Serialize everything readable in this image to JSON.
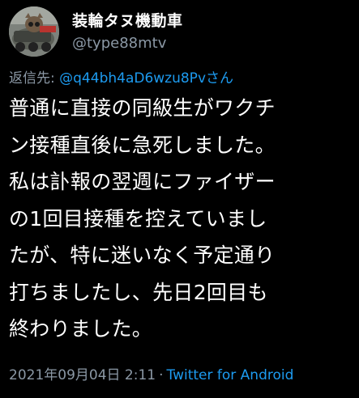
{
  "user": {
    "display_name": "装輪タヌ機動車",
    "handle": "@type88mtv"
  },
  "reply": {
    "prefix": "返信先: ",
    "target": "@q44bh4aD6wzu8Pvさん"
  },
  "body_lines": [
    "普通に直接の同級生がワクチ",
    "ン接種直後に急死しました。",
    "私は訃報の翌週にファイザー",
    "の1回目接種を控えていまし",
    "たが、特に迷いなく予定通り",
    "打ちましたし、先日2回目も",
    "終わりました。"
  ],
  "meta": {
    "timestamp": "2021年09月04日 2:11",
    "separator": "·",
    "source": "Twitter for Android"
  },
  "colors": {
    "background": "#000000",
    "text": "#ffffff",
    "secondary": "#8b98a5",
    "link": "#1d9bf0"
  }
}
